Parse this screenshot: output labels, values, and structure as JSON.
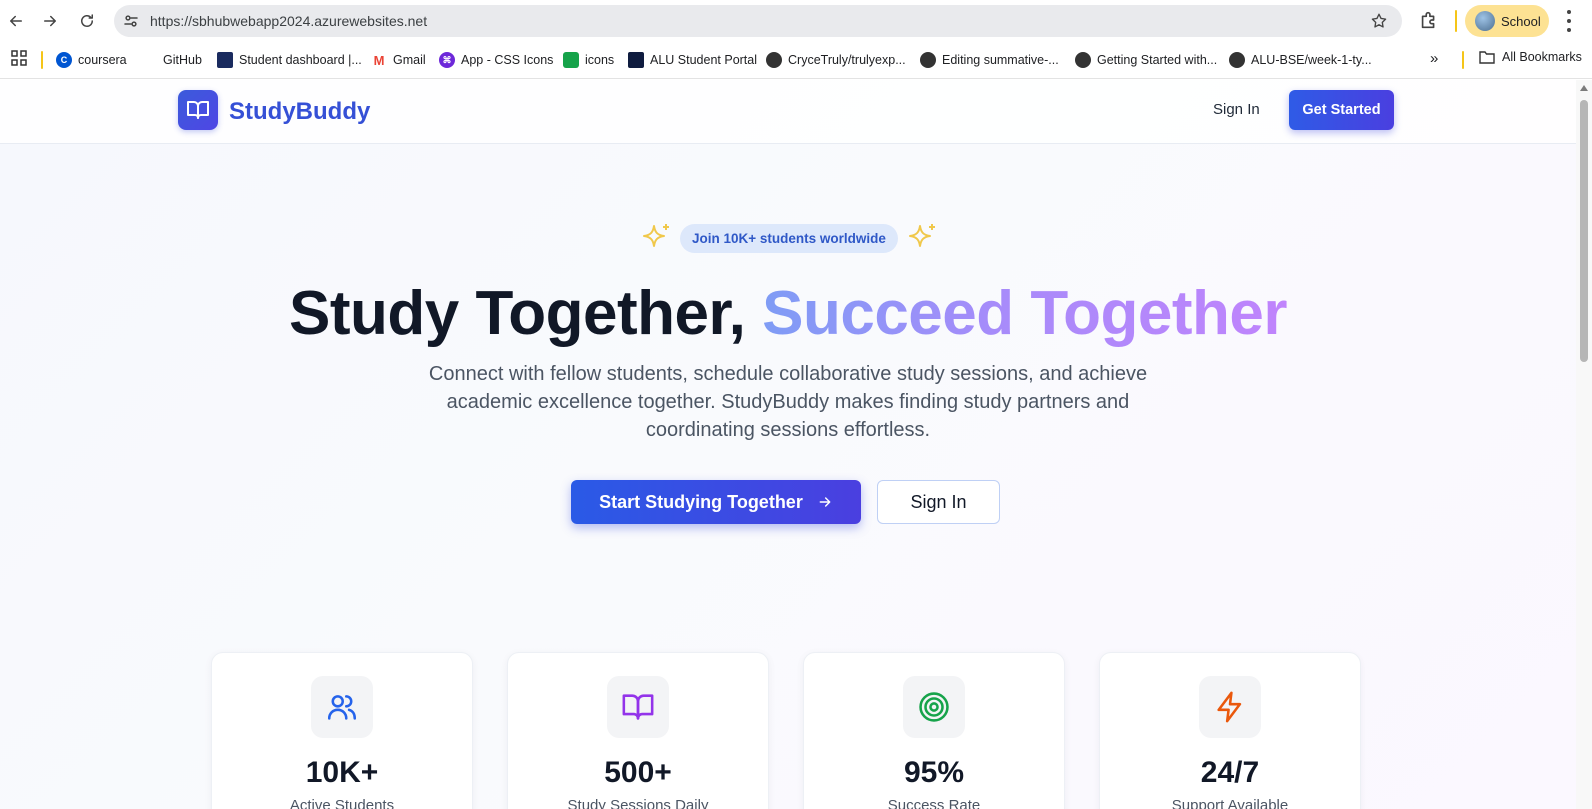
{
  "browser": {
    "url": "https://sbhubwebapp2024.azurewebsites.net",
    "profile_label": "School",
    "bookmarks": [
      {
        "label": "coursera",
        "icon": "coursera-icon",
        "color": "#0056d2"
      },
      {
        "label": "GitHub",
        "icon": "github-icon",
        "color": "#ffffff"
      },
      {
        "label": "Student dashboard |...",
        "icon": "dashboard-icon",
        "color": "#1a2b5f"
      },
      {
        "label": "Gmail",
        "icon": "gmail-icon",
        "color": "#ea4335"
      },
      {
        "label": "App - CSS Icons",
        "icon": "css-icons-icon",
        "color": "#6d28d9"
      },
      {
        "label": "icons",
        "icon": "icons-icon",
        "color": "#16a34a"
      },
      {
        "label": "ALU Student Portal",
        "icon": "alu-icon",
        "color": "#0f1c3f"
      },
      {
        "label": "CryceTruly/trulyexp...",
        "icon": "globe-icon",
        "color": "#333333"
      },
      {
        "label": "Editing summative-...",
        "icon": "globe-icon",
        "color": "#333333"
      },
      {
        "label": "Getting Started with...",
        "icon": "globe-icon",
        "color": "#333333"
      },
      {
        "label": "ALU-BSE/week-1-ty...",
        "icon": "globe-icon",
        "color": "#333333"
      }
    ],
    "more_bookmarks": "»",
    "all_bookmarks_label": "All Bookmarks"
  },
  "header": {
    "brand": "StudyBuddy",
    "sign_in": "Sign In",
    "get_started": "Get Started"
  },
  "hero": {
    "badge": "Join 10K+ students worldwide",
    "title_plain": "Study Together, ",
    "title_gradient": "Succeed Together",
    "subtitle": "Connect with fellow students, schedule collaborative study sessions, and achieve academic excellence together. StudyBuddy makes finding study partners and coordinating sessions effortless.",
    "primary_cta": "Start Studying Together",
    "secondary_cta": "Sign In"
  },
  "stats": [
    {
      "value": "10K+",
      "label": "Active Students",
      "icon": "users-icon",
      "color": "#2563eb"
    },
    {
      "value": "500+",
      "label": "Study Sessions Daily",
      "icon": "book-open-icon",
      "color": "#9333ea"
    },
    {
      "value": "95%",
      "label": "Success Rate",
      "icon": "target-icon",
      "color": "#16a34a"
    },
    {
      "value": "24/7",
      "label": "Support Available",
      "icon": "zap-icon",
      "color": "#ea580c"
    }
  ],
  "colors": {
    "brand": "#3550d6",
    "primary_button": "#2f5be6",
    "badge_bg": "#dde8fb",
    "sparkle": "#f0c84b"
  }
}
